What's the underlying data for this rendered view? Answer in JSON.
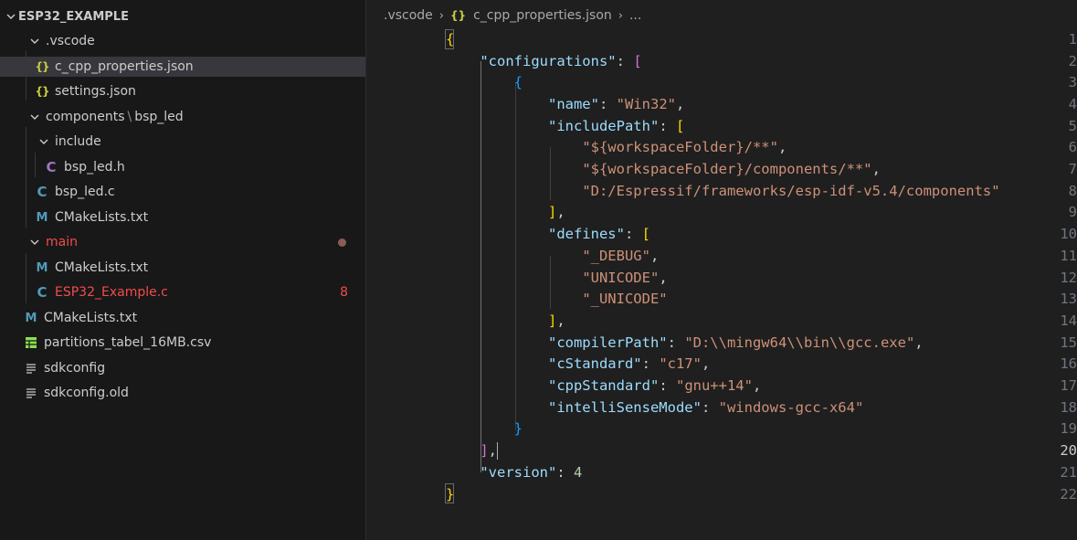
{
  "explorer": {
    "title": "ESP32_EXAMPLE",
    "items": [
      {
        "label": ".vscode",
        "kind": "folder-open"
      },
      {
        "label": "c_cpp_properties.json",
        "kind": "json",
        "icon": "{}"
      },
      {
        "label": "settings.json",
        "kind": "json",
        "icon": "{}"
      },
      {
        "label": "components",
        "label2": "bsp_led",
        "kind": "folder-open"
      },
      {
        "label": "include",
        "kind": "folder-open"
      },
      {
        "label": "bsp_led.h",
        "kind": "h",
        "icon": "C"
      },
      {
        "label": "bsp_led.c",
        "kind": "c",
        "icon": "C"
      },
      {
        "label": "CMakeLists.txt",
        "kind": "cmake",
        "icon": "M"
      },
      {
        "label": "main",
        "kind": "folder-open"
      },
      {
        "label": "CMakeLists.txt",
        "kind": "cmake",
        "icon": "M"
      },
      {
        "label": "ESP32_Example.c",
        "kind": "c",
        "icon": "C",
        "badge": "8"
      },
      {
        "label": "CMakeLists.txt",
        "kind": "cmake",
        "icon": "M"
      },
      {
        "label": "partitions_tabel_16MB.csv",
        "kind": "csv"
      },
      {
        "label": "sdkconfig",
        "kind": "text"
      },
      {
        "label": "sdkconfig.old",
        "kind": "text"
      }
    ]
  },
  "breadcrumb": {
    "folder": ".vscode",
    "file_icon": "{}",
    "file": "c_cpp_properties.json",
    "more": "..."
  },
  "editor": {
    "line_numbers": [
      "1",
      "2",
      "3",
      "4",
      "5",
      "6",
      "7",
      "8",
      "9",
      "10",
      "11",
      "12",
      "13",
      "14",
      "15",
      "16",
      "17",
      "18",
      "19",
      "20",
      "21",
      "22"
    ],
    "active_line": "20",
    "tokens": {
      "configurations": "\"configurations\"",
      "name_k": "\"name\"",
      "name_v": "\"Win32\"",
      "includePath_k": "\"includePath\"",
      "inc1": "\"${workspaceFolder}/**\"",
      "inc2": "\"${workspaceFolder}/components/**\"",
      "inc3": "\"D:/Espressif/frameworks/esp-idf-v5.4/components\"",
      "defines_k": "\"defines\"",
      "def1": "\"_DEBUG\"",
      "def2": "\"UNICODE\"",
      "def3": "\"_UNICODE\"",
      "compilerPath_k": "\"compilerPath\"",
      "compilerPath_v": "\"D:\\\\mingw64\\\\bin\\\\gcc.exe\"",
      "cStandard_k": "\"cStandard\"",
      "cStandard_v": "\"c17\"",
      "cppStandard_k": "\"cppStandard\"",
      "cppStandard_v": "\"gnu++14\"",
      "intelliSenseMode_k": "\"intelliSenseMode\"",
      "intelliSenseMode_v": "\"windows-gcc-x64\"",
      "version_k": "\"version\"",
      "version_v": "4"
    }
  },
  "colors": {
    "sidebar_bg": "#181818",
    "editor_bg": "#1f1f1f",
    "selected_row": "#37373d",
    "json_key": "#9cdcfe",
    "json_string": "#ce9178",
    "json_number": "#b5cea8",
    "error": "#f14c4c"
  }
}
